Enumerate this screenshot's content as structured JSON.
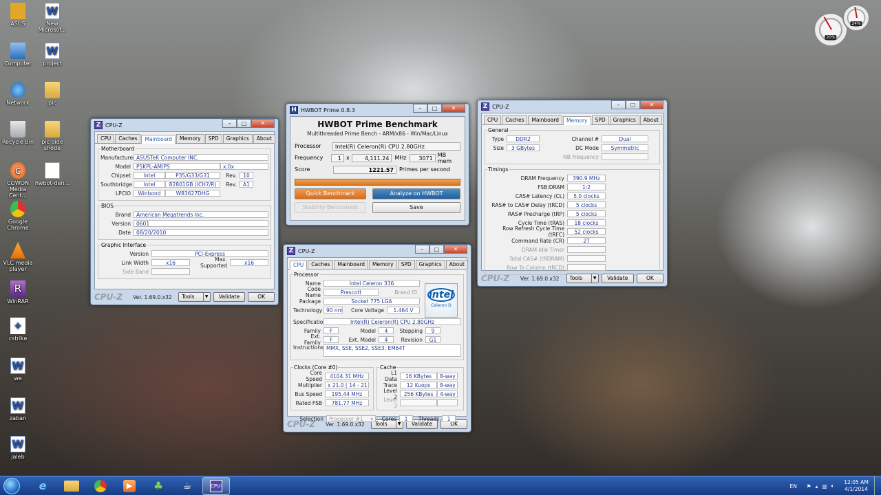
{
  "desktop_icons": [
    {
      "label": "ASUS",
      "icon": "asus-icon"
    },
    {
      "label": "New Microsof...",
      "icon": "word-doc-icon"
    },
    {
      "label": "Computer",
      "icon": "computer-icon"
    },
    {
      "label": "project",
      "icon": "word-doc-icon"
    },
    {
      "label": "Network",
      "icon": "network-icon"
    },
    {
      "label": "pic",
      "icon": "folder-icon"
    },
    {
      "label": "Recycle Bin",
      "icon": "recycle-bin-icon"
    },
    {
      "label": "pic dide shode",
      "icon": "folder-icon"
    },
    {
      "label": "COWON Media Cent...",
      "icon": "cowon-icon"
    },
    {
      "label": "hwbot-den...",
      "icon": "file-icon"
    },
    {
      "label": "Google Chrome",
      "icon": "chrome-icon"
    },
    {
      "label": "VLC media player",
      "icon": "vlc-icon"
    },
    {
      "label": "WinRAR",
      "icon": "winrar-icon"
    },
    {
      "label": "cstrike",
      "icon": "cstrike-icon"
    },
    {
      "label": "we",
      "icon": "word-doc-icon"
    },
    {
      "label": "zaban",
      "icon": "word-doc-icon"
    },
    {
      "label": "jaleb",
      "icon": "word-doc-icon"
    }
  ],
  "gadget": {
    "cpu_pct": "20%",
    "mem_pct": "24%"
  },
  "cpuz_tabs": [
    "CPU",
    "Caches",
    "Mainboard",
    "Memory",
    "SPD",
    "Graphics",
    "About"
  ],
  "cpuz_common": {
    "title": "CPU-Z",
    "logo": "CPU-Z",
    "version": "Ver. 1.69.0.x32",
    "tools": "Tools",
    "validate": "Validate",
    "ok": "OK"
  },
  "mainboard": {
    "motherboard_legend": "Motherboard",
    "manufacturer_label": "Manufacturer",
    "manufacturer": "ASUSTeK Computer INC.",
    "model_label": "Model",
    "model": "P5KPL-AM/PS",
    "model_rev": "x.0x",
    "chipset_label": "Chipset",
    "chipset_vendor": "Intel",
    "chipset": "P35/G33/G31",
    "rev_label": "Rev.",
    "chipset_rev": "10",
    "southbridge_label": "Southbridge",
    "sb_vendor": "Intel",
    "southbridge": "82801GB (ICH7/R)",
    "sb_rev": "A1",
    "lpcio_label": "LPCIO",
    "lpcio_vendor": "Winbond",
    "lpcio": "W83627DHG",
    "bios_legend": "BIOS",
    "brand_label": "Brand",
    "brand": "American Megatrends Inc.",
    "version_label": "Version",
    "version": "0601",
    "date_label": "Date",
    "date": "08/20/2010",
    "graphic_legend": "Graphic Interface",
    "gi_version_label": "Version",
    "gi_version": "PCI-Express",
    "link_width_label": "Link Width",
    "link_width": "x16",
    "max_supported_label": "Max. Supported",
    "max_supported": "x16",
    "side_band_label": "Side Band"
  },
  "hwbot": {
    "title": "HWBOT Prime 0.8.3",
    "heading": "HWBOT Prime Benchmark",
    "subtitle": "Multithreaded Prime Bench - ARM/x86 - Win/Mac/Linux",
    "processor_label": "Processor",
    "processor": "Intel(R) Celeron(R) CPU 2.80GHz",
    "frequency_label": "Frequency",
    "freq_mult": "1",
    "freq_x": "x",
    "freq_mhz": "4,111.24",
    "mhz": "MHz",
    "mem": "3071",
    "mb_mem": "MB mem",
    "score_label": "Score",
    "score": "1221.57",
    "primes": "Primes per second",
    "quick": "Quick Benchmark",
    "analyze": "Analyze on HWBOT",
    "stability": "Stability Benchmark",
    "save": "Save"
  },
  "memory": {
    "general_legend": "General",
    "type_label": "Type",
    "type": "DDR2",
    "channel_label": "Channel #",
    "channel": "Dual",
    "size_label": "Size",
    "size": "3 GBytes",
    "dc_label": "DC Mode",
    "dc": "Symmetric",
    "nb_label": "NB Frequency",
    "timings_legend": "Timings",
    "rows": [
      {
        "label": "DRAM Frequency",
        "value": "390.9 MHz",
        "dim": false
      },
      {
        "label": "FSB:DRAM",
        "value": "1:2",
        "dim": false
      },
      {
        "label": "CAS# Latency (CL)",
        "value": "5.0 clocks",
        "dim": false
      },
      {
        "label": "RAS# to CAS# Delay (tRCD)",
        "value": "5 clocks",
        "dim": false
      },
      {
        "label": "RAS# Precharge (tRP)",
        "value": "5 clocks",
        "dim": false
      },
      {
        "label": "Cycle Time (tRAS)",
        "value": "18 clocks",
        "dim": false
      },
      {
        "label": "Row Refresh Cycle Time (tRFC)",
        "value": "52 clocks",
        "dim": false
      },
      {
        "label": "Command Rate (CR)",
        "value": "2T",
        "dim": false
      },
      {
        "label": "DRAM Idle Timer",
        "value": "",
        "dim": true
      },
      {
        "label": "Total CAS# (tRDRAM)",
        "value": "",
        "dim": true
      },
      {
        "label": "Row To Column (tRCD)",
        "value": "",
        "dim": true
      }
    ]
  },
  "cpu": {
    "processor_legend": "Processor",
    "name_label": "Name",
    "name": "Intel Celeron 336",
    "codename_label": "Code Name",
    "codename": "Prescott",
    "brand_id_label": "Brand ID",
    "package_label": "Package",
    "package": "Socket 775 LGA",
    "tech_label": "Technology",
    "tech": "90 nm",
    "core_voltage_label": "Core Voltage",
    "core_voltage": "1.464 V",
    "spec_label": "Specification",
    "spec": "Intel(R) Celeron(R) CPU 2.80GHz",
    "family_label": "Family",
    "family": "F",
    "model_label": "Model",
    "model": "4",
    "stepping_label": "Stepping",
    "stepping": "9",
    "extfamily_label": "Ext. Family",
    "extfamily": "F",
    "extmodel_label": "Ext. Model",
    "extmodel": "4",
    "revision_label": "Revision",
    "revision": "G1",
    "instr_label": "Instructions",
    "instr": "MMX, SSE, SSE2, SSE3, EM64T",
    "intel_logo": "intel",
    "intel_sub": "Celeron D",
    "clocks_legend": "Clocks (Core #0)",
    "core_speed_label": "Core Speed",
    "core_speed": "4104.31 MHz",
    "multiplier_label": "Multiplier",
    "multiplier": "x 21.0 ( 14 - 21 )",
    "bus_speed_label": "Bus Speed",
    "bus_speed": "195.44 MHz",
    "rated_fsb_label": "Rated FSB",
    "rated_fsb": "781.77 MHz",
    "cache_legend": "Cache",
    "l1d_label": "L1 Data",
    "l1d": "16 KBytes",
    "l1d_way": "8-way",
    "trace_label": "Trace",
    "trace": "12 Kuops",
    "trace_way": "8-way",
    "l2_label": "Level 2",
    "l2": "256 KBytes",
    "l2_way": "4-way",
    "l3_label": "Level 3",
    "selection_label": "Selection",
    "selection": "Processor #1",
    "cores_label": "Cores",
    "cores": "1",
    "threads_label": "Threads",
    "threads": "1"
  },
  "taskbar": {
    "items": [
      "ie-icon",
      "explorer-icon",
      "chrome-icon",
      "media-player-icon",
      "messenger-icon",
      "java-icon",
      "cpuz-icon"
    ],
    "lang": "EN",
    "time": "12:05 AM",
    "date": "4/1/2014"
  }
}
